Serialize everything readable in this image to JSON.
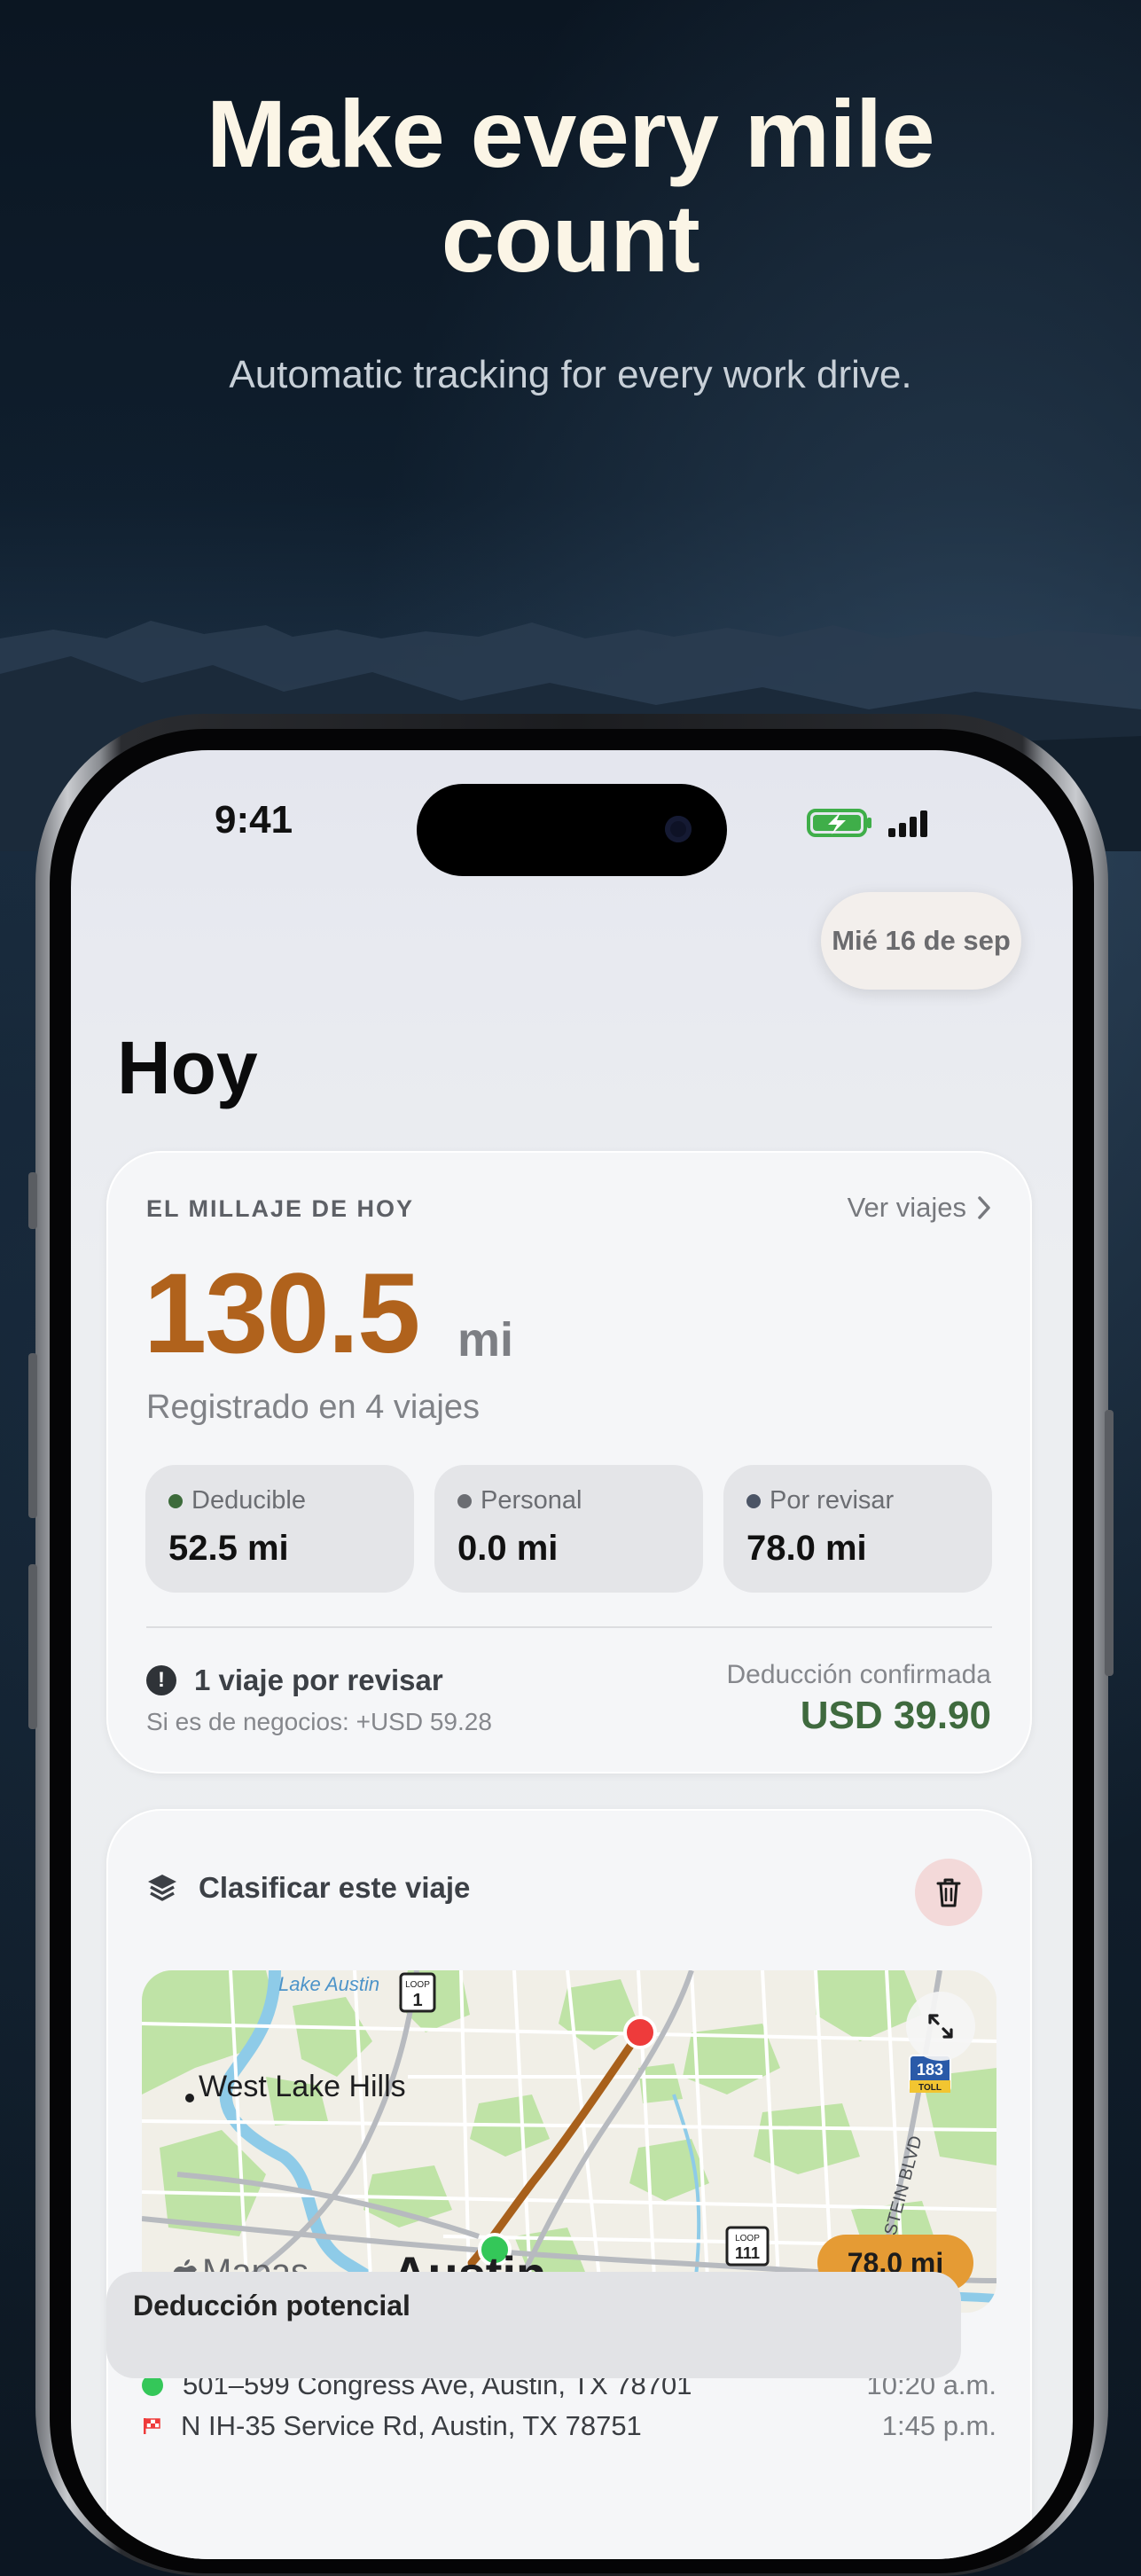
{
  "hero": {
    "headline_line1": "Make every mile",
    "headline_line2": "count",
    "subheadline": "Automatic tracking for every work drive."
  },
  "status_bar": {
    "time": "9:41",
    "icons": [
      "battery-charging-icon",
      "signal-bars-icon"
    ]
  },
  "header": {
    "date_pill": "Mié 16 de sep",
    "title": "Hoy"
  },
  "today_card": {
    "label": "EL MILLAJE DE HOY",
    "link": "Ver viajes",
    "total_value": "130.5",
    "total_unit": "mi",
    "subtitle": "Registrado en 4 viajes",
    "stats": [
      {
        "label": "Deducible",
        "value": "52.5 mi",
        "color": "#3d6b3b"
      },
      {
        "label": "Personal",
        "value": "0.0 mi",
        "color": "#6b6d72"
      },
      {
        "label": "Por revisar",
        "value": "78.0 mi",
        "color": "#4c5566"
      }
    ],
    "review_title": "1 viaje por revisar",
    "review_sub": "Si es de negocios: +USD 59.28",
    "deduction_label": "Deducción confirmada",
    "deduction_value": "USD 39.90",
    "accent_color": "#b0621c",
    "deduction_color": "#3f6a3e"
  },
  "classify_card": {
    "title": "Clasificar este viaje",
    "map": {
      "miles_badge": "78.0 mi",
      "provider": "Mapas",
      "city": "Austin",
      "area": "West Lake Hills",
      "lake": "Lake Austin",
      "shields": [
        "LOOP 1",
        "LOOP 111",
        "183 TOLL"
      ],
      "street": "STEIN BLVD",
      "route_color": "#a8601b"
    },
    "trip_start": {
      "address": "501–599 Congress Ave, Austin, TX 78701",
      "time": "10:20 a.m."
    },
    "trip_end": {
      "address": "N IH-35 Service Rd, Austin, TX 78751",
      "time": "1:45 p.m."
    },
    "next_section": "Deducción potencial"
  }
}
